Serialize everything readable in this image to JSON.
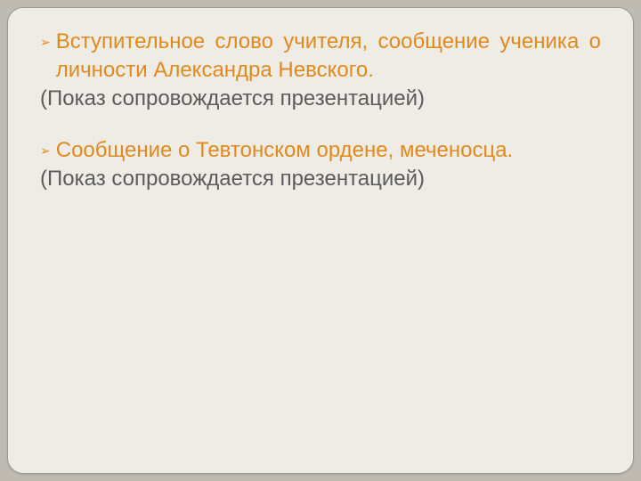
{
  "slide": {
    "blocks": [
      {
        "bullet": "➢",
        "lead": "Вступительное слово учителя, сообщение ученика о личности Александра Невского.",
        "note": "(Показ сопровождается презентацией)"
      },
      {
        "bullet": "➢",
        "lead": "Сообщение о Тевтонском ордене, меченосца.",
        "note": "(Показ сопровождается презентацией)"
      }
    ]
  }
}
